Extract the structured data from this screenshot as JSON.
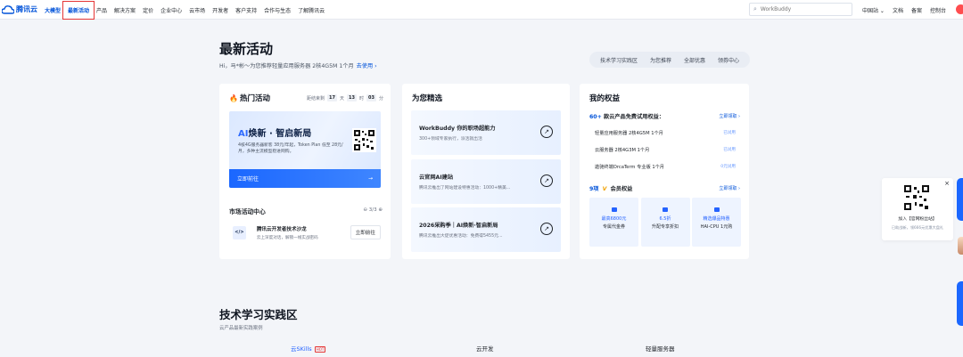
{
  "brand": {
    "name": "腾讯云"
  },
  "nav": {
    "items": [
      "大模型",
      "最新活动",
      "产品",
      "解决方案",
      "定价",
      "企业中心",
      "云市场",
      "开发者",
      "客户支持",
      "合作与生态",
      "了解腾讯云"
    ],
    "search_placeholder": "WorkBuddy",
    "right": [
      "中国站 ⌄",
      "文档",
      "备案",
      "控制台"
    ]
  },
  "hero": {
    "title": "最新活动",
    "greeting": "Hi，马*彬～为您推荐轻量应用服务器 2核4G5M 1个月",
    "greeting_link": "去使用 ›",
    "tabs": [
      "技术学习实践区",
      "为您推荐",
      "全部优惠",
      "领券中心"
    ]
  },
  "hot": {
    "title": "热门活动",
    "countdown_label": "距结束剩",
    "countdown": {
      "d": "17",
      "d_unit": "天",
      "h": "13",
      "h_unit": "时",
      "m": "03",
      "m_unit": "分"
    },
    "banner": {
      "title_ai": "AI",
      "title_rest": "焕新 · 智启新局",
      "desc": "4核4G服务器新客 38元/年起，Token Plan 低至 28元/月，多种主流模型稳进网购。",
      "cta": "立即前往",
      "cta_arrow": "→"
    },
    "market": {
      "title": "市场活动中心",
      "pager": "3/3",
      "item": {
        "name": "腾讯云开发者技术沙龙",
        "sub": "云上深度对话，解锁一线实战密码",
        "button": "立即前往",
        "logo": "</>"
      }
    }
  },
  "picks": {
    "title": "为您精选",
    "items": [
      {
        "title": "WorkBuddy 你的职场超能力",
        "desc": "300+领域专家执行，派活就出活"
      },
      {
        "title": "云官网AI建站",
        "desc": "腾讯云推出了网站建设特惠活动：1000+精美..."
      },
      {
        "title": "2026采购季｜AI焕新·智启新局",
        "desc": "腾讯云推出大促优惠活动：免费得5455元..."
      }
    ],
    "arrow": "↗"
  },
  "rights": {
    "title": "我的权益",
    "trial": {
      "count": "60+",
      "text": "款云产品免费试用权益：",
      "link": "立即领取 ›"
    },
    "rows": [
      {
        "name": "轻量应用服务器 2核4G5M 1个月",
        "status": "已试用"
      },
      {
        "name": "云服务器 2核4G3M 1个月",
        "status": "已试用"
      },
      {
        "name": "遨驰终端OrcaTerm 专业版 1个月",
        "status": "0元试用"
      }
    ],
    "vip": {
      "count": "9项",
      "v": "V",
      "text": "会员权益",
      "link": "立即领取 ›"
    },
    "perks": [
      {
        "value": "最高6800元",
        "label": "专属代金券"
      },
      {
        "value": "6.5折",
        "label": "升配专享折扣"
      },
      {
        "value": "精选爆品特惠",
        "label": "HAI-CPU 1元购"
      }
    ]
  },
  "float": {
    "title": "加入【官网粉丝站】",
    "sub": "已助战新，领666元优惠大盘礼",
    "close": "×"
  },
  "lower": {
    "title": "技术学习实践区",
    "subtitle": "云产品最新实践案例",
    "cols": [
      "云SKills",
      "云开发",
      "轻量服务器"
    ],
    "hot_badge": "HOT"
  }
}
